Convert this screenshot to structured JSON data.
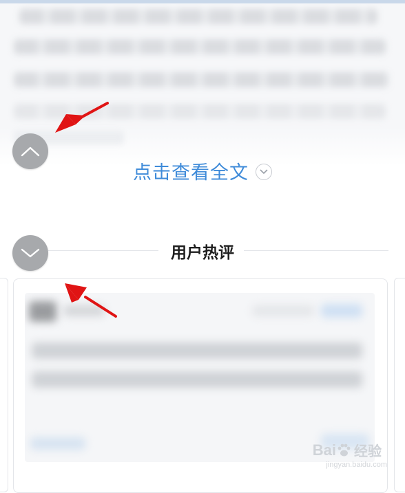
{
  "article": {
    "expand_label": "点击查看全文"
  },
  "comments": {
    "section_title": "用户热评"
  },
  "controls": {
    "scroll_up_icon": "chevron-up-icon",
    "scroll_down_icon": "chevron-down-icon"
  },
  "annotations": {
    "arrow_color": "#e01414"
  },
  "watermark": {
    "brand_left": "Bai",
    "brand_right": "经验",
    "url": "jingyan.baidu.com"
  },
  "colors": {
    "link_blue": "#3f8bd9",
    "button_gray": "#a7a9ac"
  }
}
